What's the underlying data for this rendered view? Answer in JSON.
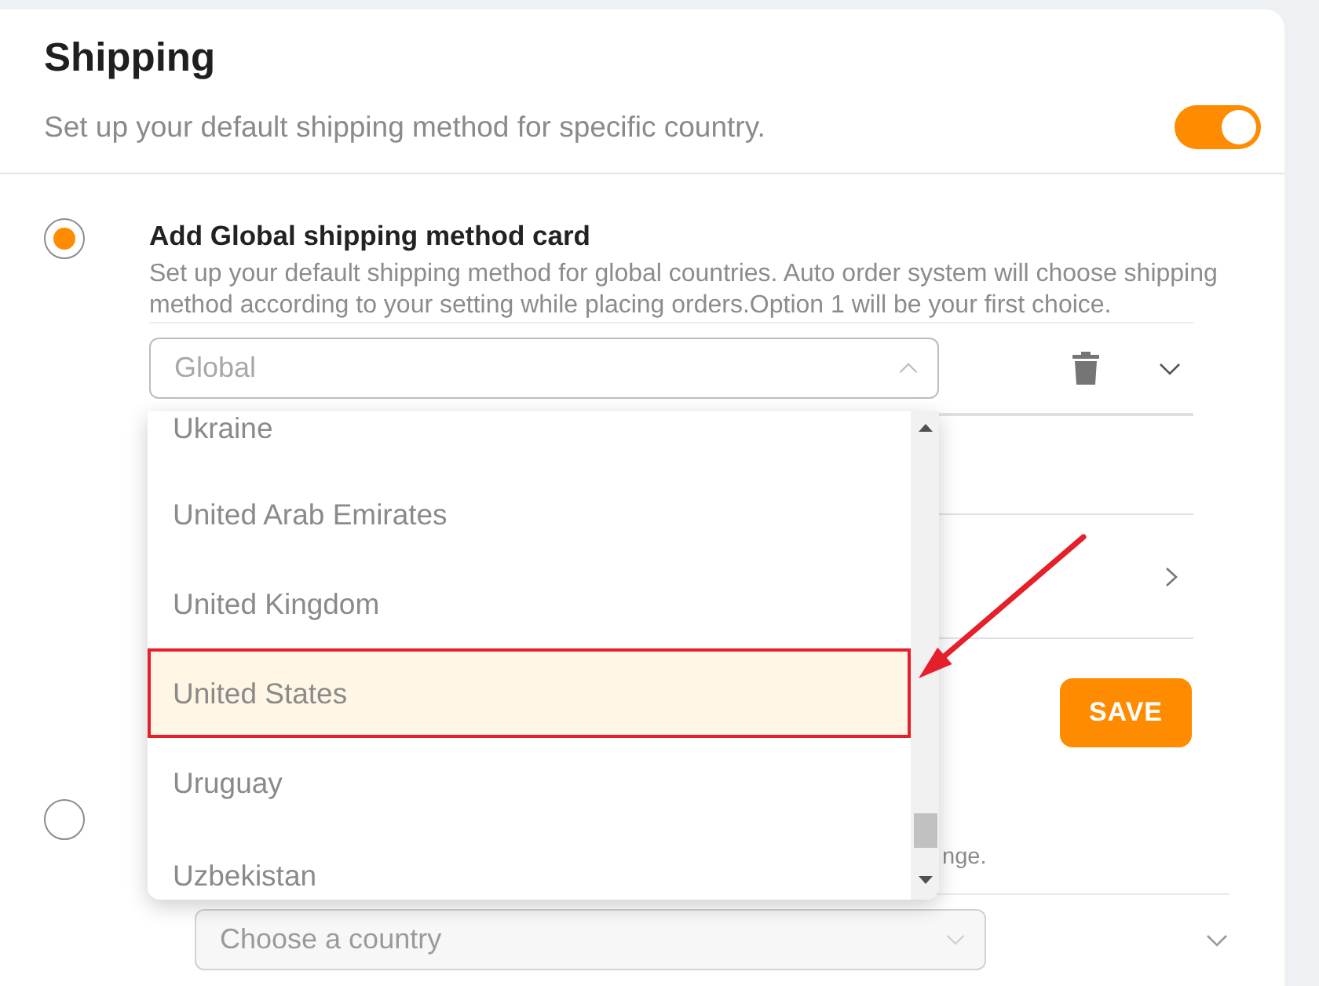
{
  "header": {
    "title": "Shipping",
    "subtitle": "Set up your default shipping method for specific country.",
    "toggle": {
      "on": true
    }
  },
  "global_card": {
    "selected": true,
    "title": "Add Global shipping method card",
    "description": "Set up your default shipping method for global countries. Auto order system will choose shipping method according to your setting while placing orders.Option 1 will be your first choice.",
    "region_select": {
      "placeholder": "Global",
      "expanded": true
    },
    "save_button": "SAVE"
  },
  "country_card": {
    "selected": false,
    "description": "nge.",
    "country_select": {
      "placeholder": "Choose a country",
      "disabled": true
    }
  },
  "dropdown": {
    "items": [
      {
        "label": "Ukraine",
        "selected": false,
        "marked": false
      },
      {
        "label": "United Arab Emirates",
        "selected": false,
        "marked": false
      },
      {
        "label": "United Kingdom",
        "selected": false,
        "marked": false
      },
      {
        "label": "United States",
        "selected": true,
        "marked": true
      },
      {
        "label": "Uruguay",
        "selected": false,
        "marked": false
      },
      {
        "label": "Uzbekistan",
        "selected": false,
        "marked": false
      }
    ]
  },
  "annotation": {
    "arrow": true
  }
}
